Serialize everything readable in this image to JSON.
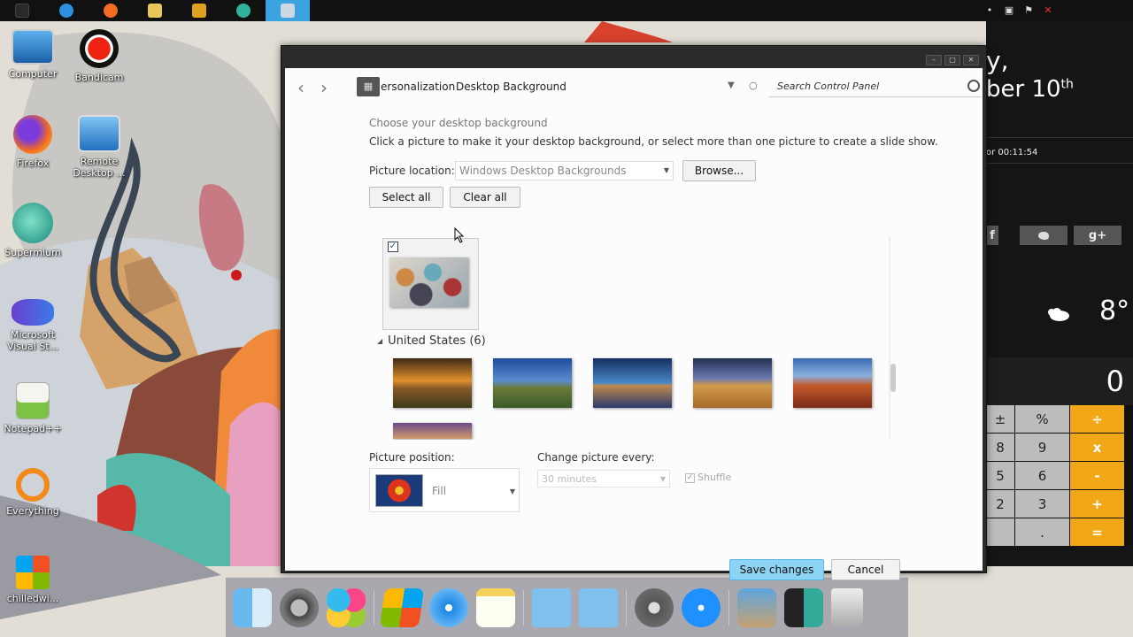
{
  "colors": {
    "window_chrome": "#2b2b2b",
    "save_button": "#8dd3f3",
    "calc_operator": "#f2a716",
    "taskbar_active": "#3ba3e0"
  },
  "taskbar": {
    "items": [
      {
        "name": "start-icon",
        "color": "#555555"
      },
      {
        "name": "internet-explorer-icon",
        "color": "#2c8fe0"
      },
      {
        "name": "firefox-icon",
        "color": "#f26c21"
      },
      {
        "name": "file-explorer-icon",
        "color": "#e8c85a"
      },
      {
        "name": "media-player-icon",
        "color": "#e0a020"
      },
      {
        "name": "supermium-icon",
        "color": "#2fb39a"
      },
      {
        "name": "control-panel-icon",
        "color": "#cfd8e0"
      }
    ]
  },
  "desktop_icons": [
    {
      "label": "Computer",
      "icon": "computer-icon"
    },
    {
      "label": "Bandicam",
      "icon": "bandicam-icon"
    },
    {
      "label": "Firefox",
      "icon": "firefox-icon"
    },
    {
      "label": "Remote Desktop ...",
      "icon": "remote-desktop-icon"
    },
    {
      "label": "Supermium",
      "icon": "supermium-icon"
    },
    {
      "label": "Microsoft Visual St...",
      "icon": "visual-studio-icon"
    },
    {
      "label": "Notepad++",
      "icon": "notepadpp-icon"
    },
    {
      "label": "Everything",
      "icon": "everything-search-icon"
    },
    {
      "label": "chilledwi...",
      "icon": "windows-logo-icon"
    }
  ],
  "widgets": {
    "day_suffix": "y,",
    "date_partial": "ber 10",
    "date_sup": "th",
    "uptime": "or 00:11:54",
    "social": [
      "f",
      "",
      "g+"
    ],
    "temperature": "8°",
    "calc_display": "0",
    "calc_keys": [
      "±",
      "%",
      "÷",
      "8",
      "9",
      "x",
      "5",
      "6",
      "-",
      "2",
      "3",
      "+",
      "",
      ".",
      "="
    ]
  },
  "window": {
    "breadcrumb_1": "ersonalization",
    "breadcrumb_2": "Desktop Background",
    "search_placeholder": "Search Control Panel",
    "heading": "Choose your desktop background",
    "subheading": "Click a picture to make it your desktop background, or select more than one picture to create a slide show.",
    "picture_location_label": "Picture location:",
    "picture_location_value": "Windows Desktop Backgrounds",
    "browse_label": "Browse...",
    "select_all_label": "Select all",
    "clear_all_label": "Clear all",
    "group_title": "United States (6)",
    "picture_position_label": "Picture position:",
    "picture_position_value": "Fill",
    "change_every_label": "Change picture every:",
    "change_every_value": "30 minutes",
    "shuffle_label": "Shuffle",
    "save_label": "Save changes",
    "cancel_label": "Cancel"
  }
}
